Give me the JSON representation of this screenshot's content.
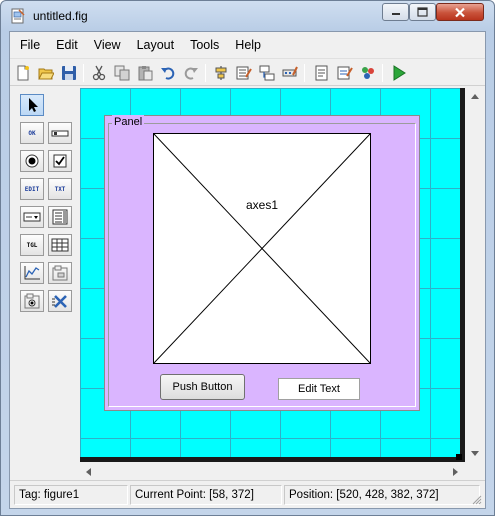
{
  "window": {
    "title": "untitled.fig",
    "icon": "fig-file-icon",
    "controls": [
      "minimize-icon",
      "maximize-icon",
      "close-icon"
    ]
  },
  "menubar": {
    "items": [
      {
        "label": "File"
      },
      {
        "label": "Edit"
      },
      {
        "label": "View"
      },
      {
        "label": "Layout"
      },
      {
        "label": "Tools"
      },
      {
        "label": "Help"
      }
    ]
  },
  "toolbar": {
    "buttons": [
      "new-figure-icon",
      "open-icon",
      "save-icon",
      "cut-icon",
      "copy-icon",
      "paste-icon",
      "undo-icon",
      "redo-icon",
      "align-objects-icon",
      "menu-editor-icon",
      "tab-order-editor-icon",
      "toolbar-editor-icon",
      "mfile-editor-icon",
      "property-inspector-icon",
      "object-browser-icon",
      "run-figure-icon"
    ]
  },
  "palette": {
    "tools": [
      {
        "name": "select-tool",
        "text": ""
      },
      {
        "name": "push-button-tool",
        "text": "OK"
      },
      {
        "name": "slider-tool",
        "text": ""
      },
      {
        "name": "radio-button-tool",
        "text": ""
      },
      {
        "name": "checkbox-tool",
        "text": ""
      },
      {
        "name": "edit-text-tool",
        "text": "EDIT"
      },
      {
        "name": "static-text-tool",
        "text": "TXT"
      },
      {
        "name": "popup-menu-tool",
        "text": ""
      },
      {
        "name": "listbox-tool",
        "text": ""
      },
      {
        "name": "toggle-button-tool",
        "text": "TGL"
      },
      {
        "name": "table-tool",
        "text": ""
      },
      {
        "name": "axes-tool",
        "text": ""
      },
      {
        "name": "panel-tool",
        "text": ""
      },
      {
        "name": "button-group-tool",
        "text": ""
      },
      {
        "name": "activex-control-tool",
        "text": ""
      }
    ]
  },
  "canvas": {
    "background_color": "#00ffff",
    "panel": {
      "title": "Panel",
      "color": "#dab5ff",
      "axes_label": "axes1",
      "push_button_label": "Push Button",
      "edit_text_value": "Edit Text"
    }
  },
  "status": {
    "tag": "Tag: figure1",
    "current_point": "Current Point:  [58, 372]",
    "position": "Position: [520, 428, 382, 372]"
  }
}
